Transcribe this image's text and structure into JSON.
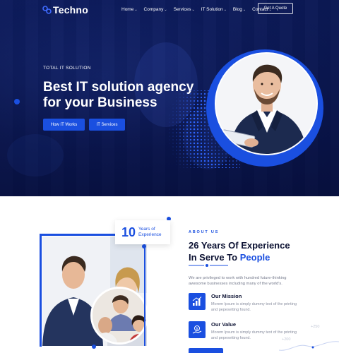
{
  "brand": {
    "name": "Techno",
    "accent": "#1a4fe0",
    "dark": "#0c1233"
  },
  "nav": {
    "items": [
      {
        "label": "Home",
        "has_dropdown": true
      },
      {
        "label": "Company",
        "has_dropdown": true
      },
      {
        "label": "Services",
        "has_dropdown": true
      },
      {
        "label": "IT Solution",
        "has_dropdown": true
      },
      {
        "label": "Blog",
        "has_dropdown": true
      },
      {
        "label": "Contact",
        "has_dropdown": true
      }
    ],
    "cta_label": "Get A Quote",
    "caret_icon": "chevron-down-icon"
  },
  "hero": {
    "eyebrow": "TOTAL IT SOLUTION",
    "title_line1": "Best IT solution agency",
    "title_line2": "for your Business",
    "buttons": [
      {
        "label": "How IT Works"
      },
      {
        "label": "IT Services"
      }
    ],
    "image": "businessman-with-tablet"
  },
  "about": {
    "eyebrow": "ABOUT US",
    "title_line1": "26 Years Of Experience",
    "title_line2_prefix": "In Serve To ",
    "title_line2_highlight": "People",
    "description": "We are privileged to work with hundred future-thinking awesome businesses including many of the world's.",
    "experience": {
      "number": "10",
      "label": "Years of Experience"
    },
    "features": [
      {
        "title": "Our Mission",
        "text": "Morem Ipsum is simply dummy text of the printing and pepesetting found.",
        "icon": "chart-growth-icon"
      },
      {
        "title": "Our Value",
        "text": "Morem Ipsum is simply dummy text of the printing and pepesetting found.",
        "icon": "money-hand-icon"
      }
    ],
    "chart_labels": [
      "+250",
      "+200"
    ]
  }
}
